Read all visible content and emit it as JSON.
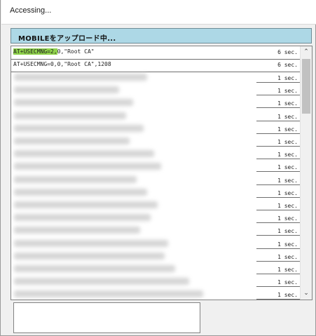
{
  "window": {
    "title": "Accessing..."
  },
  "banner": {
    "text": "MOBILEをアップロード中..."
  },
  "log": {
    "rows": [
      {
        "cmd_highlight": "AT+USECMNG=2,",
        "cmd_rest": "0,\"Root CA\"",
        "time": "6 sec."
      },
      {
        "cmd": "AT+USECMNG=0,0,\"Root CA\",1208",
        "time": "6 sec."
      }
    ],
    "blurred_time_label": "1 sec."
  },
  "scroll": {
    "up_icon": "chevron-up-icon",
    "down_icon": "chevron-down-icon"
  },
  "colors": {
    "banner_bg": "#add8e6",
    "highlight": "#8fd24b"
  }
}
